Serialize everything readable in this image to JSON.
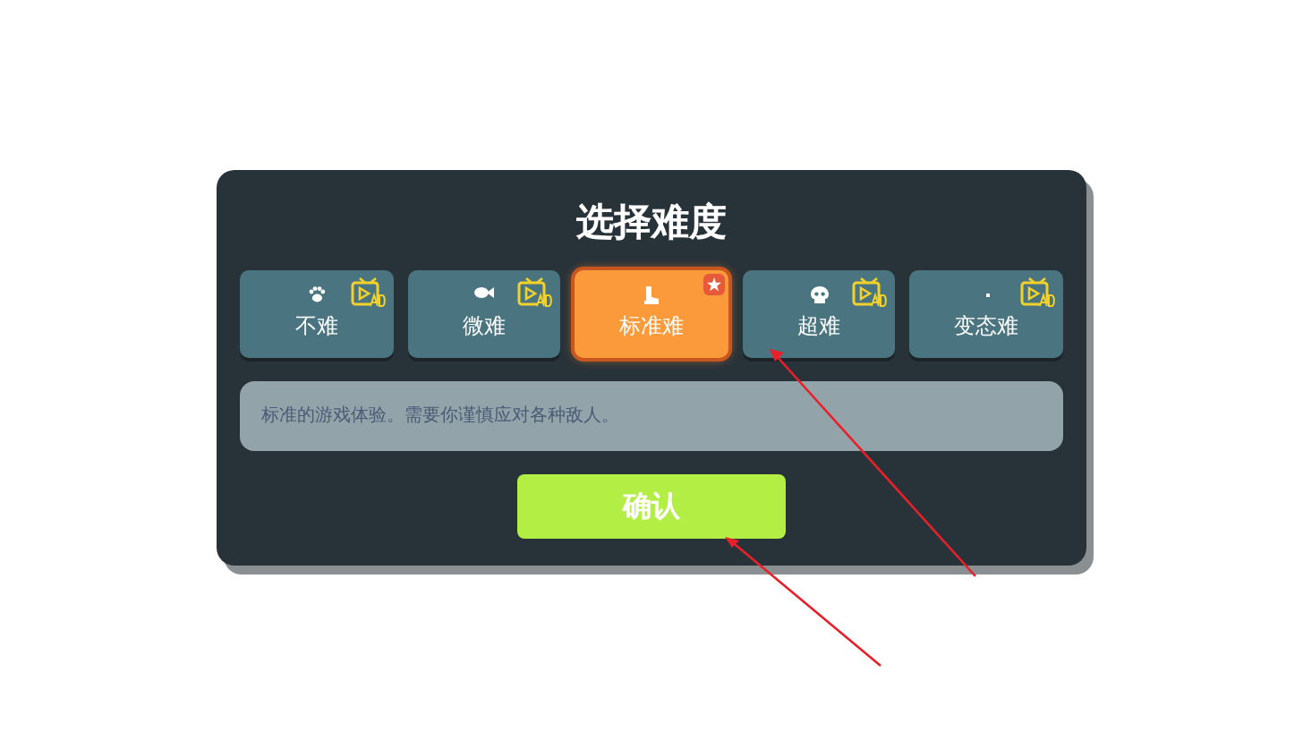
{
  "dialog": {
    "title": "选择难度",
    "difficulties": [
      {
        "label": "不难",
        "selected": false,
        "ad": true,
        "recommended": false
      },
      {
        "label": "微难",
        "selected": false,
        "ad": true,
        "recommended": false
      },
      {
        "label": "标准难",
        "selected": true,
        "ad": false,
        "recommended": true
      },
      {
        "label": "超难",
        "selected": false,
        "ad": true,
        "recommended": false
      },
      {
        "label": "变态难",
        "selected": false,
        "ad": true,
        "recommended": false
      }
    ],
    "description": "标准的游戏体验。需要你谨慎应对各种敌人。",
    "confirm": "确认"
  }
}
